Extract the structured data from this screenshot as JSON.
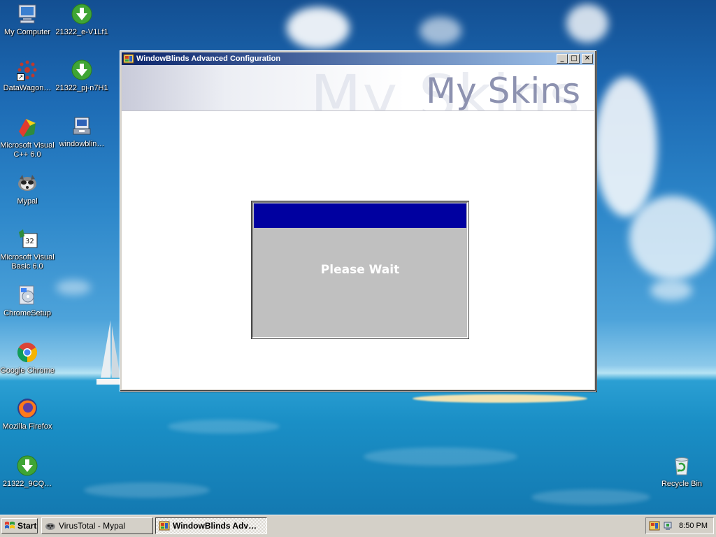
{
  "desktop": {
    "icons": [
      {
        "label": "My Computer",
        "icon": "my-computer-icon"
      },
      {
        "label": "21322_e-V1Lf1",
        "icon": "download-file-icon"
      },
      {
        "label": "DataWagon…",
        "icon": "datawagon-icon"
      },
      {
        "label": "21322_pj-n7H1",
        "icon": "download-file-icon"
      },
      {
        "label": "Microsoft Visual C++ 6.0",
        "icon": "visual-cpp-icon"
      },
      {
        "label": "windowblin…",
        "icon": "installer-icon"
      },
      {
        "label": "Mypal",
        "icon": "mypal-raccoon-icon"
      },
      {
        "label": "Microsoft Visual Basic 6.0",
        "icon": "visual-basic-icon"
      },
      {
        "label": "ChromeSetup",
        "icon": "chrome-setup-icon"
      },
      {
        "label": "Google Chrome",
        "icon": "chrome-icon"
      },
      {
        "label": "Mozilla Firefox",
        "icon": "firefox-icon"
      },
      {
        "label": "21322_9CQ…",
        "icon": "download-file-icon"
      },
      {
        "label": "Recycle Bin",
        "icon": "recycle-bin-icon"
      }
    ]
  },
  "window": {
    "title": "WindowBlinds Advanced Configuration",
    "banner_title": "My Skins",
    "banner_watermark": "My Skins",
    "buttons": {
      "minimize": "_",
      "maximize": "□",
      "close": "✕"
    }
  },
  "wait_dialog": {
    "message": "Please Wait",
    "bar_color": "#0000a0"
  },
  "taskbar": {
    "start_label": "Start",
    "tasks": [
      {
        "label": "VirusTotal - Mypal",
        "active": false
      },
      {
        "label": "WindowBlinds Adv…",
        "active": true
      }
    ],
    "clock": "8:50 PM"
  }
}
